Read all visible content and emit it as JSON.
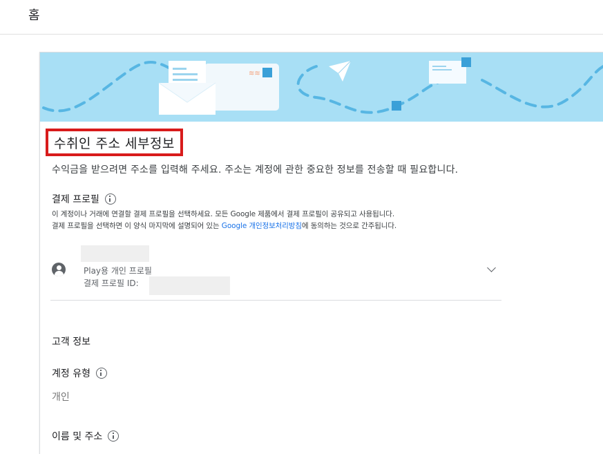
{
  "header": {
    "title": "홈"
  },
  "card": {
    "title": "수취인 주소 세부정보",
    "description": "수익금을 받으려면 주소를 입력해 주세요. 주소는 계정에 관한 중요한 정보를 전송할 때 필요합니다.",
    "payment_profile": {
      "label": "결제 프로필",
      "note_line1": "이 계정이나 거래에 연결할 결제 프로필을 선택하세요. 모든 Google 제품에서 결제 프로필이 공유되고 사용됩니다.",
      "note_line2_prefix": "결제 프로필을 선택하면 이 양식 마지막에 설명되어 있는 ",
      "note_link": "Google 개인정보처리방침",
      "note_line2_suffix": "에 동의하는 것으로 간주됩니다.",
      "profile_type": "Play용 개인 프로필",
      "profile_id_label": "결제 프로필 ID:"
    },
    "customer_info": {
      "heading": "고객 정보",
      "account_type_label": "계정 유형",
      "account_type_value": "개인",
      "name_address_label": "이름 및 주소"
    }
  },
  "icons": {
    "info": "info-icon",
    "account": "account-circle-icon",
    "chevron": "chevron-down-icon"
  },
  "colors": {
    "banner": "#a8dff5",
    "highlight_border": "#d81b1b",
    "link": "#1a73e8"
  }
}
